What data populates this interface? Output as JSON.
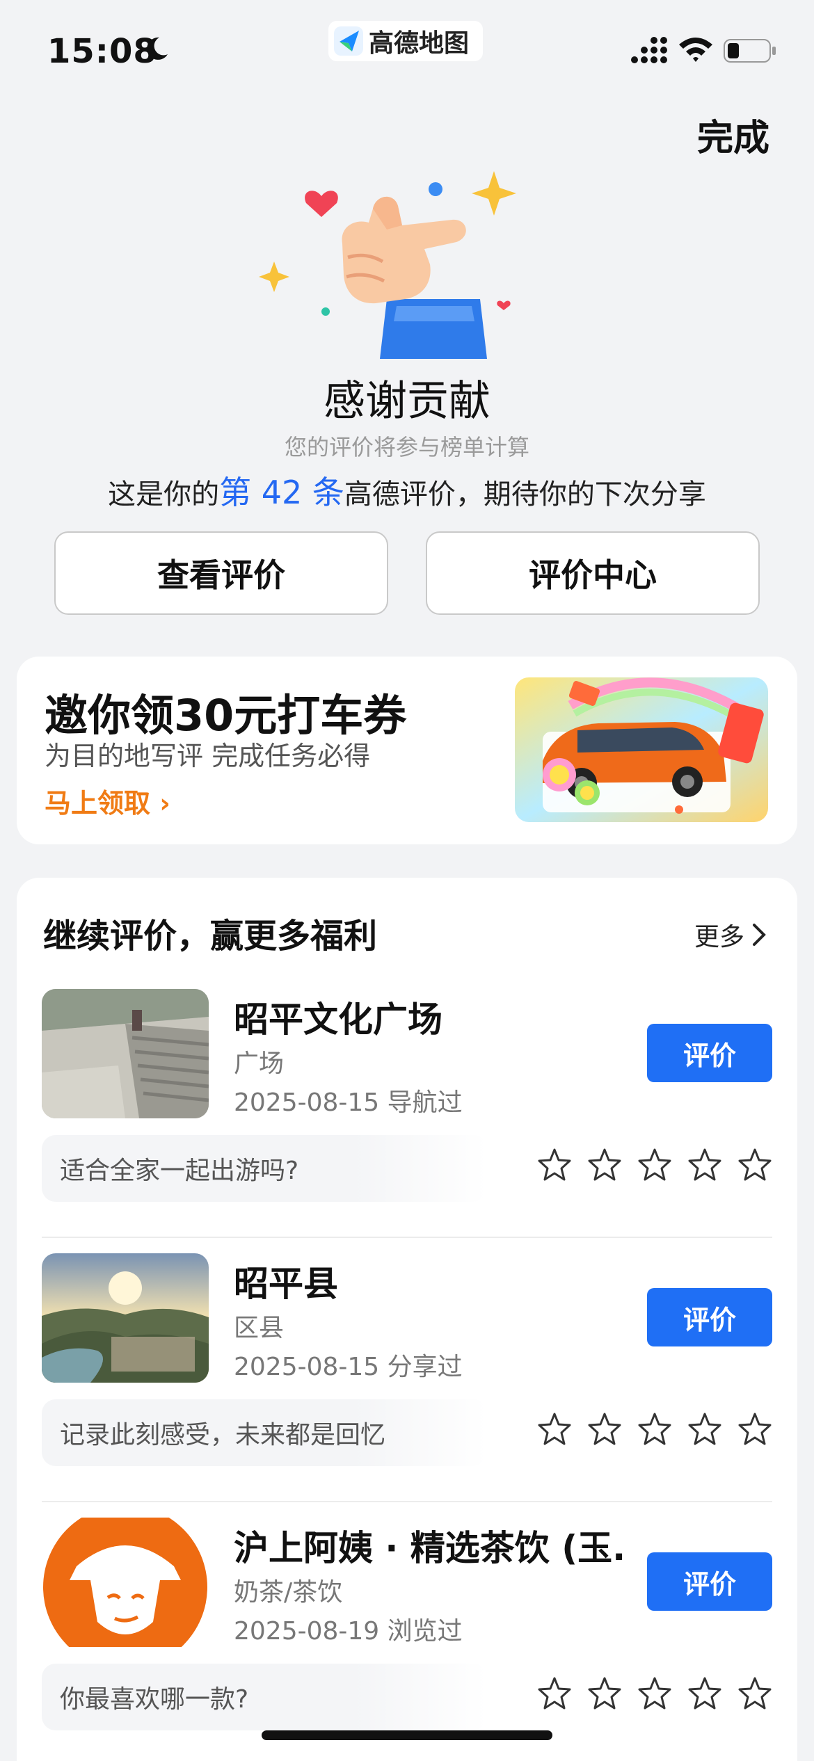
{
  "status": {
    "time": "15:08",
    "app_name": "高德地图"
  },
  "header": {
    "done_label": "完成"
  },
  "thanks": {
    "title": "感谢贡献",
    "subtitle": "您的评价将参与榜单计算",
    "line_prefix": "这是你的",
    "line_highlight": "第 42 条",
    "line_suffix": "高德评价，期待你的下次分享",
    "view_button": "查看评价",
    "center_button": "评价中心"
  },
  "promo": {
    "title": "邀你领30元打车券",
    "subtitle": "为目的地写评 完成任务必得",
    "link_label": "马上领取 ›"
  },
  "review_list": {
    "title": "继续评价，赢更多福利",
    "more_label": "更多",
    "items": [
      {
        "name": "昭平文化广场",
        "category": "广场",
        "date": "2025-08-15 导航过",
        "button": "评价",
        "question": "适合全家一起出游吗?",
        "thumb": "plaza-photo"
      },
      {
        "name": "昭平县",
        "category": "区县",
        "date": "2025-08-15 分享过",
        "button": "评价",
        "question": "记录此刻感受，未来都是回忆",
        "thumb": "aerial-town-photo"
      },
      {
        "name": "沪上阿姨 · 精选茶饮 (玉...",
        "category": "奶茶/茶饮",
        "date": "2025-08-19 浏览过",
        "button": "评价",
        "question": "你最喜欢哪一款?",
        "thumb": "brand-logo"
      }
    ]
  },
  "colors": {
    "accent": "#1f6ff5",
    "highlight": "#2468f2",
    "promo_link": "#f07b14",
    "background": "#f2f3f5"
  }
}
